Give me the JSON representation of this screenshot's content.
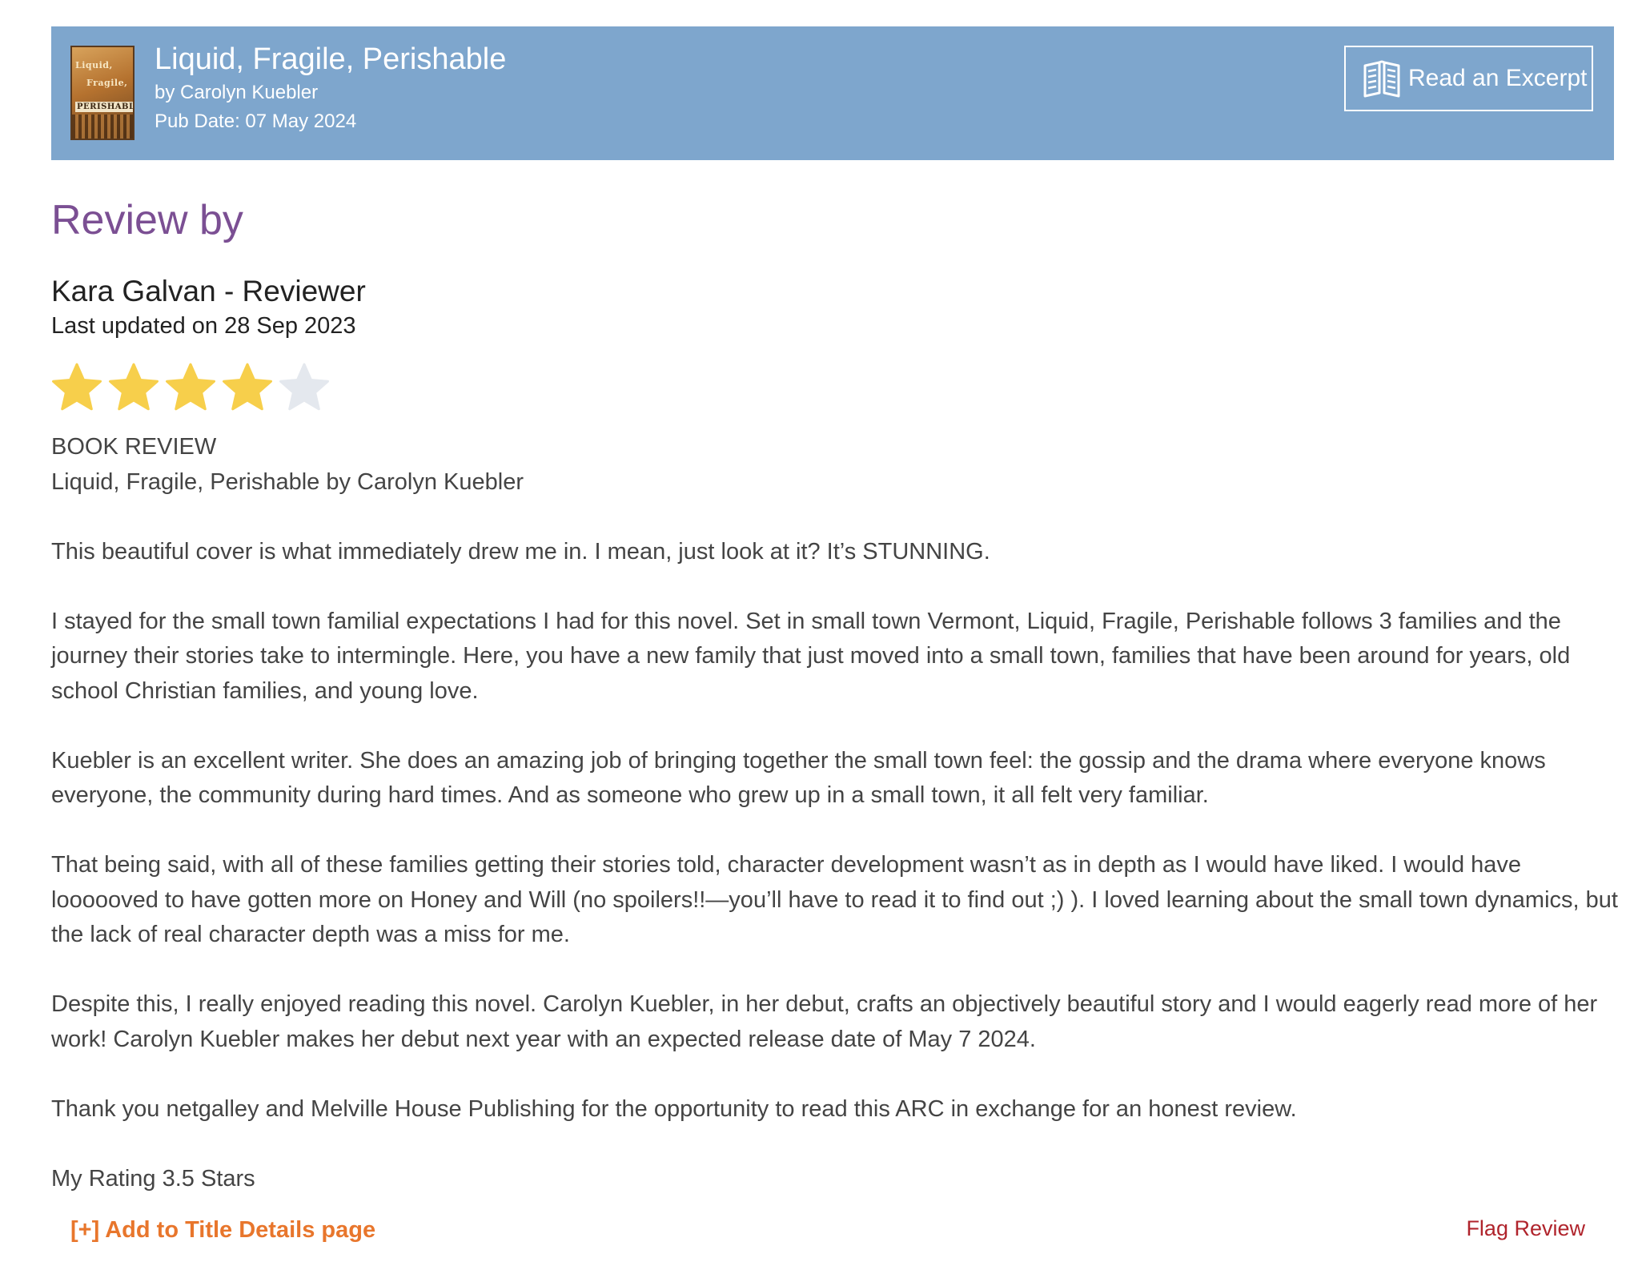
{
  "header": {
    "book_title": "Liquid, Fragile, Perishable",
    "author_line": "by Carolyn Kuebler",
    "pub_date_line": "Pub Date: 07 May 2024",
    "cover_text_1": "Liquid,",
    "cover_text_2": "Fragile,",
    "cover_text_3": "PERISHABLE",
    "excerpt_button_label": "Read an Excerpt",
    "excerpt_icon": "open-book-icon"
  },
  "review": {
    "heading": "Review by",
    "reviewer": "Kara Galvan - Reviewer",
    "last_updated": "Last updated on 28 Sep 2023",
    "rating": {
      "value": 4,
      "max": 5
    },
    "paragraphs": [
      "BOOK REVIEW",
      "Liquid, Fragile, Perishable by Carolyn Kuebler",
      "This beautiful cover is what immediately drew me in. I mean, just look at it? It’s STUNNING.",
      "I stayed for the small town familial expectations I had for this novel. Set in small town Vermont, Liquid, Fragile, Perishable follows 3 families and the journey their stories take to intermingle. Here, you have a new family that just moved into a small town, families that have been around for years, old school Christian families, and young love.",
      "Kuebler is an excellent writer. She does an amazing job of bringing together the small town feel: the gossip and the drama where everyone knows everyone, the community during hard times. And as someone who grew up in a small town, it all felt very familiar.",
      "That being said, with all of these families getting their stories told, character development wasn’t as in depth as I would have liked. I would have loooooved to have gotten more on Honey and Will (no spoilers!!—you’ll have to read it to find out ;) ). I loved learning about the small town dynamics, but the lack of real character depth was a miss for me.",
      "Despite this, I really enjoyed reading this novel. Carolyn Kuebler, in her debut, crafts an objectively beautiful story and I would eagerly read more of her work! Carolyn Kuebler makes her debut next year with an expected release date of May 7 2024.",
      "Thank you netgalley and Melville House Publishing for the opportunity to read this ARC in exchange for an honest review.",
      "My Rating 3.5 Stars"
    ]
  },
  "footer": {
    "add_link": "[+] Add to Title Details page",
    "flag_link": "Flag Review"
  },
  "colors": {
    "header_bg": "#7ea6cd",
    "heading_purple": "#7b4f93",
    "star_filled": "#f7cf4b",
    "star_empty": "#e4e8ee",
    "add_link_orange": "#e8762c",
    "flag_link_red": "#b0242c"
  }
}
